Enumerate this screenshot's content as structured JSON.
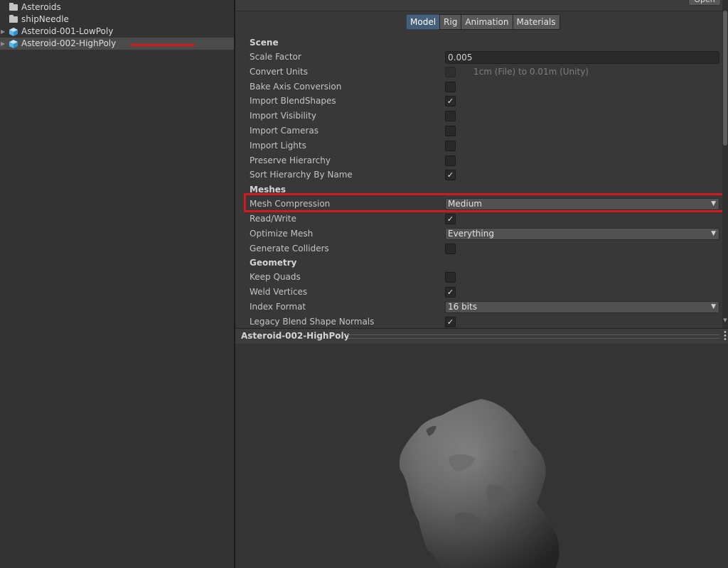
{
  "project": {
    "items": [
      {
        "label": "Asteroids",
        "icon": "folder-icon"
      },
      {
        "label": "shipNeedle",
        "icon": "folder-icon"
      },
      {
        "label": "Asteroid-001-LowPoly",
        "icon": "model-prefab-icon"
      },
      {
        "label": "Asteroid-002-HighPoly",
        "icon": "model-prefab-icon"
      }
    ]
  },
  "inspector": {
    "open_label": "Open",
    "tabs": [
      "Model",
      "Rig",
      "Animation",
      "Materials"
    ],
    "active_tab": "Model",
    "scene": {
      "title": "Scene",
      "scale_factor_label": "Scale Factor",
      "scale_factor_value": "0.005",
      "convert_units_label": "Convert Units",
      "convert_units_hint": "1cm (File) to 0.01m (Unity)",
      "bake_axis_label": "Bake Axis Conversion",
      "import_blendshapes_label": "Import BlendShapes",
      "import_visibility_label": "Import Visibility",
      "import_cameras_label": "Import Cameras",
      "import_lights_label": "Import Lights",
      "preserve_hierarchy_label": "Preserve Hierarchy",
      "sort_hierarchy_label": "Sort Hierarchy By Name"
    },
    "meshes": {
      "title": "Meshes",
      "mesh_compression_label": "Mesh Compression",
      "mesh_compression_value": "Medium",
      "read_write_label": "Read/Write",
      "optimize_mesh_label": "Optimize Mesh",
      "optimize_mesh_value": "Everything",
      "generate_colliders_label": "Generate Colliders"
    },
    "geometry": {
      "title": "Geometry",
      "keep_quads_label": "Keep Quads",
      "weld_vertices_label": "Weld Vertices",
      "index_format_label": "Index Format",
      "index_format_value": "16 bits",
      "legacy_blend_label": "Legacy Blend Shape Normals"
    },
    "checkboxes": {
      "convert_units": false,
      "bake_axis": false,
      "import_blendshapes": true,
      "import_visibility": false,
      "import_cameras": false,
      "import_lights": false,
      "preserve_hierarchy": false,
      "sort_hierarchy": true,
      "read_write": true,
      "generate_colliders": false,
      "keep_quads": false,
      "weld_vertices": true,
      "legacy_blend": true
    }
  },
  "preview": {
    "title": "Asteroid-002-HighPoly"
  },
  "colors": {
    "highlight": "#d4191a",
    "active_tab": "#46607c"
  }
}
